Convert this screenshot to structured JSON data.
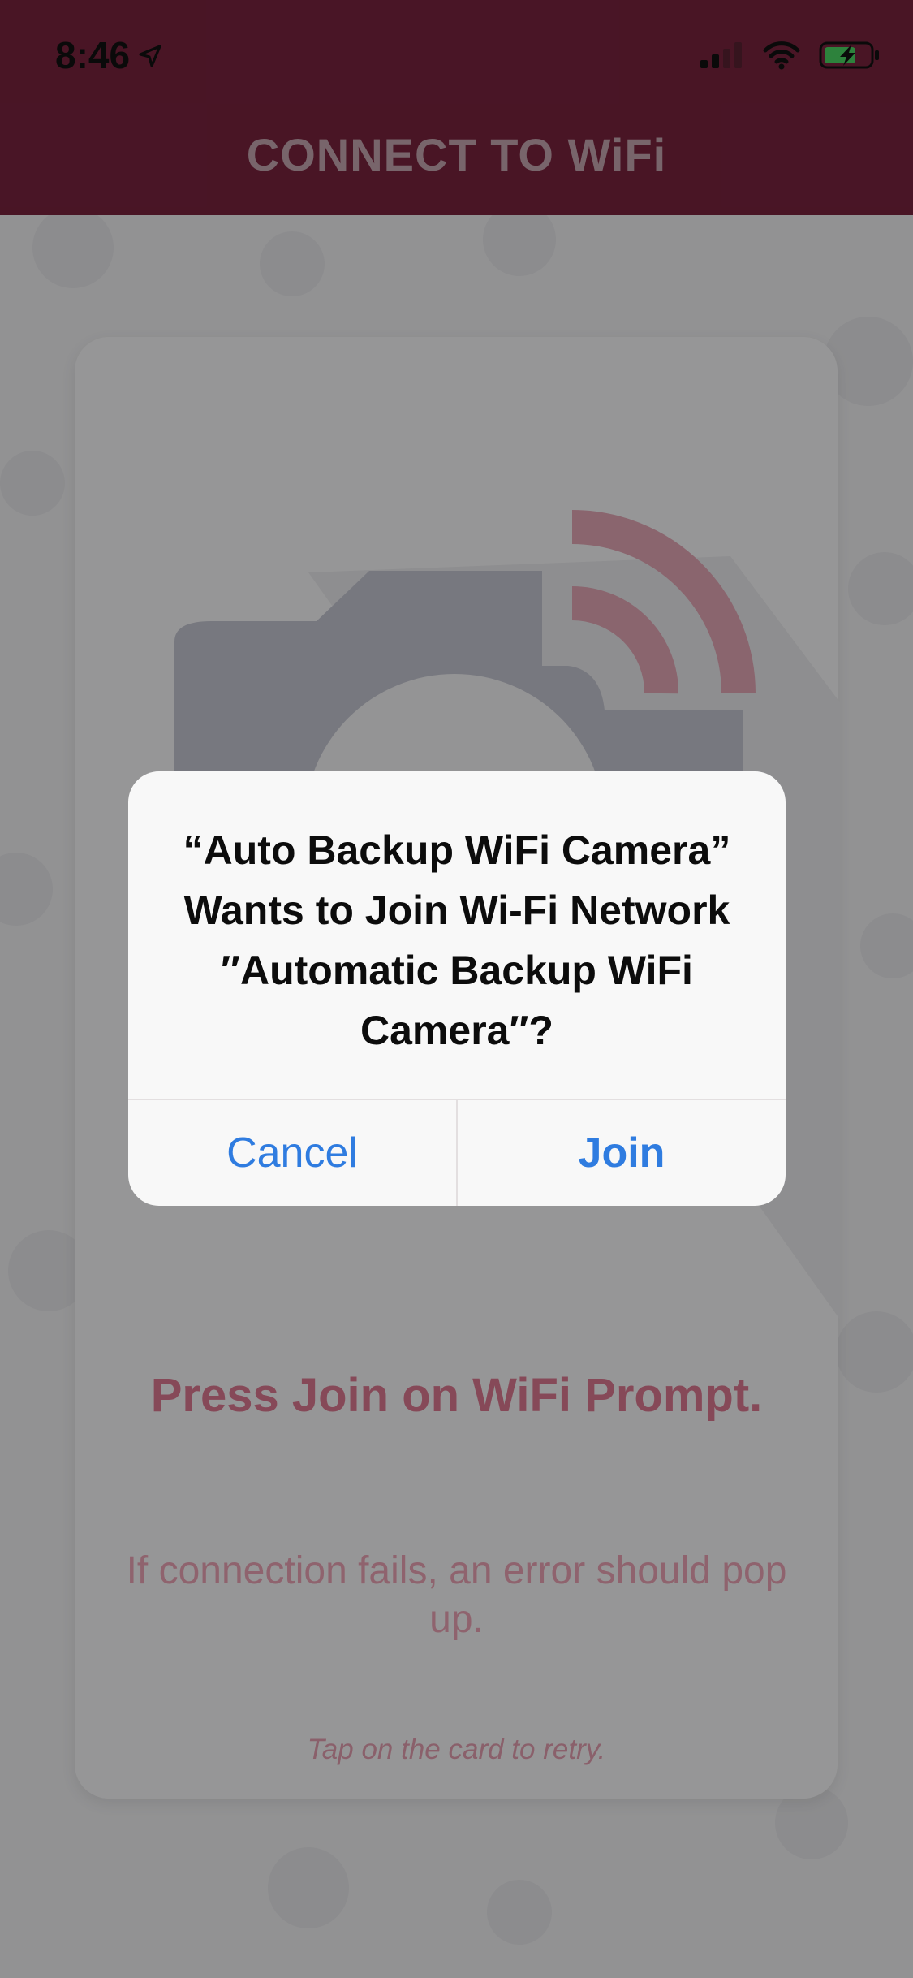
{
  "status_bar": {
    "time": "8:46",
    "location_icon": "location-arrow-icon",
    "signal_icon": "cellular-signal-icon",
    "wifi_icon": "wifi-icon",
    "battery_icon": "battery-charging-icon"
  },
  "header": {
    "title": "CONNECT TO WiFi"
  },
  "card": {
    "illustration": "camera-wifi-icon",
    "title": "Press Join on WiFi Prompt.",
    "subtitle": "If connection fails, an error should pop up.",
    "hint": "Tap on the card to retry."
  },
  "alert": {
    "message": "“Auto Backup WiFi Camera” Wants to Join Wi-Fi Network ″Automatic Backup WiFi Camera″?",
    "cancel_label": "Cancel",
    "join_label": "Join"
  },
  "colors": {
    "header_bg": "#7a233f",
    "accent_pink": "#e07a93",
    "alert_button_blue": "#2f7ce0",
    "battery_green": "#4cd964"
  }
}
